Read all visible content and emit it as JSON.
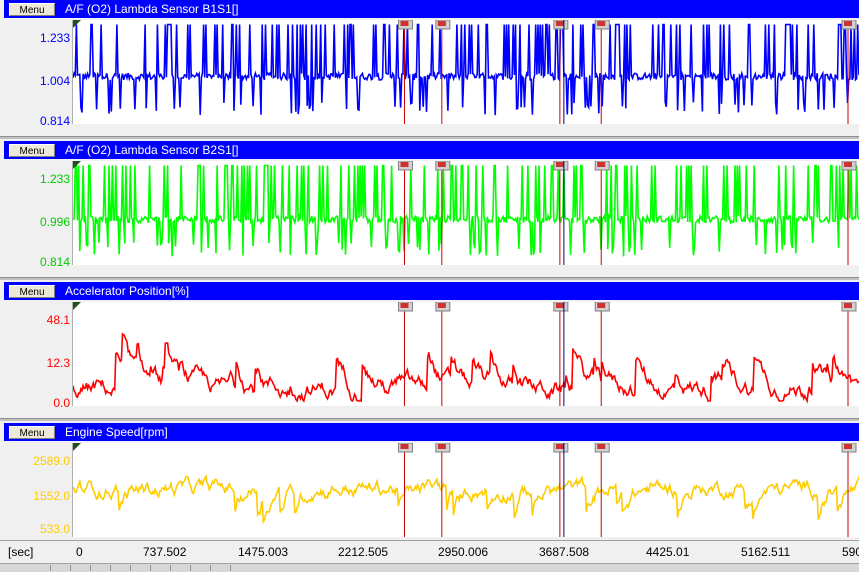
{
  "menu_label": "Menu",
  "panels": [
    {
      "title": "A/F (O2) Lambda Sensor B1S1[]",
      "y_max": "1.233",
      "y_mid": "1.004",
      "y_min": "0.814",
      "color": "#0000ff"
    },
    {
      "title": "A/F (O2) Lambda Sensor B2S1[]",
      "y_max": "1.233",
      "y_mid": "0.996",
      "y_min": "0.814",
      "color": "#00ff00"
    },
    {
      "title": "Accelerator Position[%]",
      "y_max": "48.1",
      "y_mid": "12.3",
      "y_min": "0.0",
      "color": "#ff0000"
    },
    {
      "title": "Engine Speed[rpm]",
      "y_max": "2589.0",
      "y_mid": "1552.0",
      "y_min": "533.0",
      "color": "#ffcc00"
    }
  ],
  "time_axis": {
    "unit": "[sec]",
    "ticks": [
      "0",
      "737.502",
      "1475.003",
      "2212.505",
      "2950.006",
      "3687.508",
      "4425.01",
      "5162.511",
      "590"
    ]
  },
  "markers": {
    "red_times_sec": [
      2485,
      2765,
      3650,
      3960,
      5810
    ],
    "cursor_time_sec": 3680,
    "flag_icon_color": "#cc3333",
    "cursor_color": "#000080"
  },
  "chart_data": [
    {
      "type": "line",
      "title": "A/F (O2) Lambda Sensor B1S1[]",
      "ylim": [
        0.814,
        1.233
      ],
      "ticks": [
        0.814,
        1.004,
        1.233
      ],
      "series": [
        {
          "name": "A/F (O2) Lambda Sensor B1S1[]",
          "color": "#0000ff",
          "baseline": 1.004,
          "kind": "switching"
        }
      ]
    },
    {
      "type": "line",
      "title": "A/F (O2) Lambda Sensor B2S1[]",
      "ylim": [
        0.814,
        1.233
      ],
      "ticks": [
        0.814,
        0.996,
        1.233
      ],
      "series": [
        {
          "name": "A/F (O2) Lambda Sensor B2S1[]",
          "color": "#00ff00",
          "baseline": 0.996,
          "kind": "switching"
        }
      ]
    },
    {
      "type": "line",
      "title": "Accelerator Position[%]",
      "ylim": [
        0.0,
        48.1
      ],
      "ticks": [
        0.0,
        12.3,
        48.1
      ],
      "series": [
        {
          "name": "Accelerator Position[%]",
          "color": "#ff0000",
          "baseline": 6,
          "kind": "spiky"
        }
      ]
    },
    {
      "type": "line",
      "title": "Engine Speed[rpm]",
      "ylim": [
        533.0,
        2589.0
      ],
      "ticks": [
        533.0,
        1552.0,
        2589.0
      ],
      "series": [
        {
          "name": "Engine Speed[rpm]",
          "color": "#ffcc00",
          "baseline": 1600,
          "kind": "noisy"
        }
      ]
    }
  ]
}
